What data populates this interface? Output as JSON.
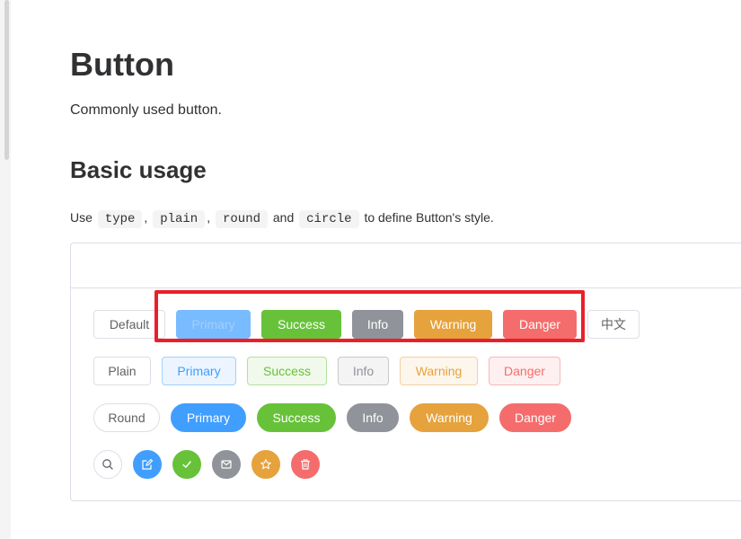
{
  "page": {
    "title": "Button",
    "description": "Commonly used button."
  },
  "section": {
    "title": "Basic usage",
    "usage": {
      "prefix": "Use",
      "code_type": "type",
      "sep1": ",",
      "code_plain": "plain",
      "sep2": ",",
      "code_round": "round",
      "and": "and",
      "code_circle": "circle",
      "suffix": "to define Button's style."
    }
  },
  "demo": {
    "row1": {
      "default": "Default",
      "primary": "Primary",
      "success": "Success",
      "info": "Info",
      "warning": "Warning",
      "danger": "Danger",
      "chinese": "中文"
    },
    "row2": {
      "plain": "Plain",
      "primary": "Primary",
      "success": "Success",
      "info": "Info",
      "warning": "Warning",
      "danger": "Danger"
    },
    "row3": {
      "round": "Round",
      "primary": "Primary",
      "success": "Success",
      "info": "Info",
      "warning": "Warning",
      "danger": "Danger"
    },
    "row4_icons": [
      "search-icon",
      "edit-icon",
      "check-icon",
      "message-icon",
      "star-icon",
      "delete-icon"
    ]
  },
  "colors": {
    "primary": "#409eff",
    "success": "#67c23a",
    "info": "#909399",
    "warning": "#e6a23c",
    "danger": "#f56c6c",
    "highlight": "#e8202a"
  }
}
